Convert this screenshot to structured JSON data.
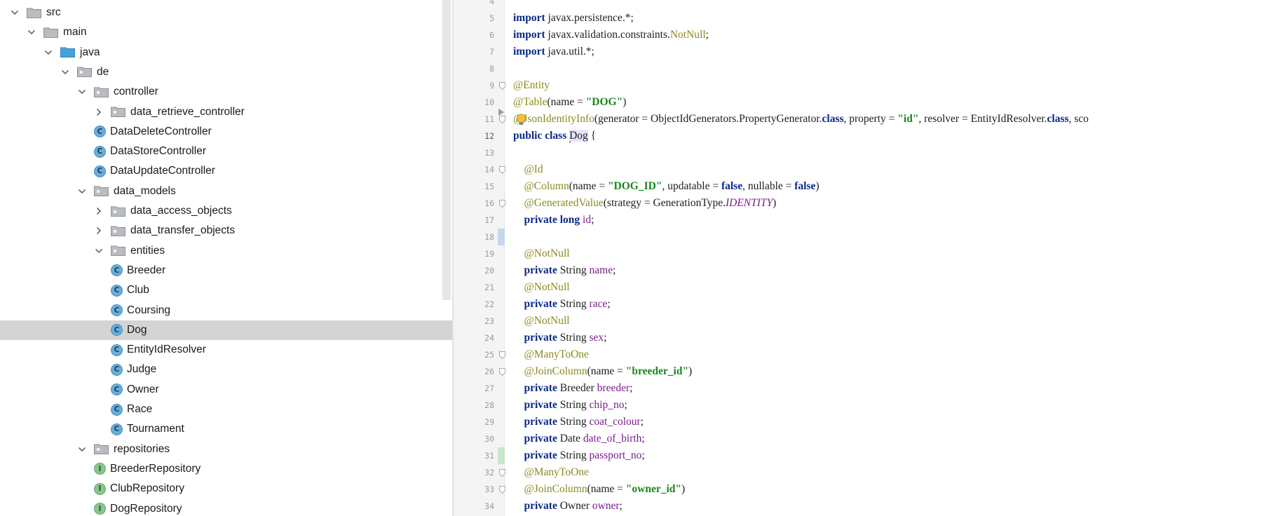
{
  "project_tree": {
    "items": [
      {
        "label": "src",
        "depth": 0,
        "kind": "folder",
        "expanded": true
      },
      {
        "label": "main",
        "depth": 1,
        "kind": "folder",
        "expanded": true
      },
      {
        "label": "java",
        "depth": 2,
        "kind": "source-folder",
        "expanded": true
      },
      {
        "label": "de",
        "depth": 3,
        "kind": "package",
        "expanded": true
      },
      {
        "label": "controller",
        "depth": 4,
        "kind": "package",
        "expanded": true
      },
      {
        "label": "data_retrieve_controller",
        "depth": 5,
        "kind": "package",
        "expanded": false
      },
      {
        "label": "DataDeleteController",
        "depth": 5,
        "kind": "class"
      },
      {
        "label": "DataStoreController",
        "depth": 5,
        "kind": "class"
      },
      {
        "label": "DataUpdateController",
        "depth": 5,
        "kind": "class"
      },
      {
        "label": "data_models",
        "depth": 4,
        "kind": "package",
        "expanded": true
      },
      {
        "label": "data_access_objects",
        "depth": 5,
        "kind": "package",
        "expanded": false
      },
      {
        "label": "data_transfer_objects",
        "depth": 5,
        "kind": "package",
        "expanded": false
      },
      {
        "label": "entities",
        "depth": 5,
        "kind": "package",
        "expanded": true
      },
      {
        "label": "Breeder",
        "depth": 6,
        "kind": "class"
      },
      {
        "label": "Club",
        "depth": 6,
        "kind": "class"
      },
      {
        "label": "Coursing",
        "depth": 6,
        "kind": "class"
      },
      {
        "label": "Dog",
        "depth": 6,
        "kind": "class",
        "selected": true
      },
      {
        "label": "EntityIdResolver",
        "depth": 6,
        "kind": "class"
      },
      {
        "label": "Judge",
        "depth": 6,
        "kind": "class"
      },
      {
        "label": "Owner",
        "depth": 6,
        "kind": "class"
      },
      {
        "label": "Race",
        "depth": 6,
        "kind": "class"
      },
      {
        "label": "Tournament",
        "depth": 6,
        "kind": "class"
      },
      {
        "label": "repositories",
        "depth": 4,
        "kind": "package",
        "expanded": true
      },
      {
        "label": "BreederRepository",
        "depth": 5,
        "kind": "interface"
      },
      {
        "label": "ClubRepository",
        "depth": 5,
        "kind": "interface"
      },
      {
        "label": "DogRepository",
        "depth": 5,
        "kind": "interface"
      }
    ],
    "class_badge": "C",
    "interface_badge": "I"
  },
  "editor": {
    "current_line": 12,
    "lines": [
      {
        "n": "4",
        "tokens": []
      },
      {
        "n": "5",
        "tokens": [
          [
            "kw",
            "import"
          ],
          [
            "t",
            " javax.persistence.*;"
          ]
        ]
      },
      {
        "n": "6",
        "tokens": [
          [
            "kw",
            "import"
          ],
          [
            "t",
            " javax.validation.constraints."
          ],
          [
            "ann",
            "NotNull"
          ],
          [
            "t",
            ";"
          ]
        ]
      },
      {
        "n": "7",
        "tokens": [
          [
            "kw",
            "import"
          ],
          [
            "t",
            " java.util.*;"
          ]
        ]
      },
      {
        "n": "8",
        "tokens": []
      },
      {
        "n": "9",
        "tokens": [
          [
            "ann",
            "@Entity"
          ]
        ]
      },
      {
        "n": "10",
        "tokens": [
          [
            "ann",
            "@Table"
          ],
          [
            "t",
            "(name = "
          ],
          [
            "str",
            "\"DOG\""
          ],
          [
            "t",
            ")"
          ]
        ]
      },
      {
        "n": "11",
        "tokens": [
          [
            "ann",
            "@JsonIdentityInfo"
          ],
          [
            "t",
            "(generator = ObjectIdGenerators.PropertyGenerator."
          ],
          [
            "kw",
            "class"
          ],
          [
            "t",
            ", property = "
          ],
          [
            "str",
            "\"id\""
          ],
          [
            "t",
            ", resolver = EntityIdResolver."
          ],
          [
            "kw",
            "class"
          ],
          [
            "t",
            ", sco"
          ]
        ]
      },
      {
        "n": "12",
        "tokens": [
          [
            "kw",
            "public class"
          ],
          [
            "t",
            " "
          ],
          [
            "caret",
            ""
          ],
          [
            "dog",
            "Dog"
          ],
          [
            "t",
            " {"
          ]
        ]
      },
      {
        "n": "13",
        "tokens": []
      },
      {
        "n": "14",
        "tokens": [
          [
            "t",
            "    "
          ],
          [
            "ann",
            "@Id"
          ]
        ]
      },
      {
        "n": "15",
        "tokens": [
          [
            "t",
            "    "
          ],
          [
            "ann",
            "@Column"
          ],
          [
            "t",
            "(name = "
          ],
          [
            "str",
            "\"DOG_ID\""
          ],
          [
            "t",
            ", updatable = "
          ],
          [
            "kw",
            "false"
          ],
          [
            "t",
            ", nullable = "
          ],
          [
            "kw",
            "false"
          ],
          [
            "t",
            ")"
          ]
        ]
      },
      {
        "n": "16",
        "tokens": [
          [
            "t",
            "    "
          ],
          [
            "ann",
            "@GeneratedValue"
          ],
          [
            "t",
            "(strategy = GenerationType."
          ],
          [
            "ital",
            "IDENTITY"
          ],
          [
            "t",
            ")"
          ]
        ]
      },
      {
        "n": "17",
        "tokens": [
          [
            "t",
            "    "
          ],
          [
            "kw",
            "private long"
          ],
          [
            "t",
            " "
          ],
          [
            "fld",
            "id"
          ],
          [
            "t",
            ";"
          ]
        ]
      },
      {
        "n": "18",
        "tokens": []
      },
      {
        "n": "19",
        "tokens": [
          [
            "t",
            "    "
          ],
          [
            "ann",
            "@NotNull"
          ]
        ]
      },
      {
        "n": "20",
        "tokens": [
          [
            "t",
            "    "
          ],
          [
            "kw",
            "private"
          ],
          [
            "t",
            " String "
          ],
          [
            "fld",
            "name"
          ],
          [
            "t",
            ";"
          ]
        ]
      },
      {
        "n": "21",
        "tokens": [
          [
            "t",
            "    "
          ],
          [
            "ann",
            "@NotNull"
          ]
        ]
      },
      {
        "n": "22",
        "tokens": [
          [
            "t",
            "    "
          ],
          [
            "kw",
            "private"
          ],
          [
            "t",
            " String "
          ],
          [
            "fld",
            "race"
          ],
          [
            "t",
            ";"
          ]
        ]
      },
      {
        "n": "23",
        "tokens": [
          [
            "t",
            "    "
          ],
          [
            "ann",
            "@NotNull"
          ]
        ]
      },
      {
        "n": "24",
        "tokens": [
          [
            "t",
            "    "
          ],
          [
            "kw",
            "private"
          ],
          [
            "t",
            " String "
          ],
          [
            "fld",
            "sex"
          ],
          [
            "t",
            ";"
          ]
        ]
      },
      {
        "n": "25",
        "tokens": [
          [
            "t",
            "    "
          ],
          [
            "ann",
            "@ManyToOne"
          ]
        ]
      },
      {
        "n": "26",
        "tokens": [
          [
            "t",
            "    "
          ],
          [
            "ann",
            "@JoinColumn"
          ],
          [
            "t",
            "(name = "
          ],
          [
            "str",
            "\"breeder_id\""
          ],
          [
            "t",
            ")"
          ]
        ]
      },
      {
        "n": "27",
        "tokens": [
          [
            "t",
            "    "
          ],
          [
            "kw",
            "private"
          ],
          [
            "t",
            " Breeder "
          ],
          [
            "fld",
            "breeder"
          ],
          [
            "t",
            ";"
          ]
        ]
      },
      {
        "n": "28",
        "tokens": [
          [
            "t",
            "    "
          ],
          [
            "kw",
            "private"
          ],
          [
            "t",
            " String "
          ],
          [
            "fld",
            "chip_no"
          ],
          [
            "t",
            ";"
          ]
        ]
      },
      {
        "n": "29",
        "tokens": [
          [
            "t",
            "    "
          ],
          [
            "kw",
            "private"
          ],
          [
            "t",
            " String "
          ],
          [
            "fld",
            "coat_colour"
          ],
          [
            "t",
            ";"
          ]
        ]
      },
      {
        "n": "30",
        "tokens": [
          [
            "t",
            "    "
          ],
          [
            "kw",
            "private"
          ],
          [
            "t",
            " Date "
          ],
          [
            "fld",
            "date_of_birth"
          ],
          [
            "t",
            ";"
          ]
        ]
      },
      {
        "n": "31",
        "tokens": [
          [
            "t",
            "    "
          ],
          [
            "kw",
            "private"
          ],
          [
            "t",
            " String "
          ],
          [
            "fld",
            "passport_no"
          ],
          [
            "t",
            ";"
          ]
        ]
      },
      {
        "n": "32",
        "tokens": [
          [
            "t",
            "    "
          ],
          [
            "ann",
            "@ManyToOne"
          ]
        ]
      },
      {
        "n": "33",
        "tokens": [
          [
            "t",
            "    "
          ],
          [
            "ann",
            "@JoinColumn"
          ],
          [
            "t",
            "(name = "
          ],
          [
            "str",
            "\"owner_id\""
          ],
          [
            "t",
            ")"
          ]
        ]
      },
      {
        "n": "34",
        "tokens": [
          [
            "t",
            "    "
          ],
          [
            "kw",
            "private"
          ],
          [
            "t",
            " Owner "
          ],
          [
            "fld",
            "owner"
          ],
          [
            "t",
            ";"
          ]
        ]
      }
    ]
  },
  "colors": {
    "keyword": "#0b2a87",
    "annotation": "#8a8a20",
    "string": "#17881a",
    "field": "#7a1c8c",
    "selected_row": "#d4d4d4",
    "current_line": "#fdfbe8"
  }
}
